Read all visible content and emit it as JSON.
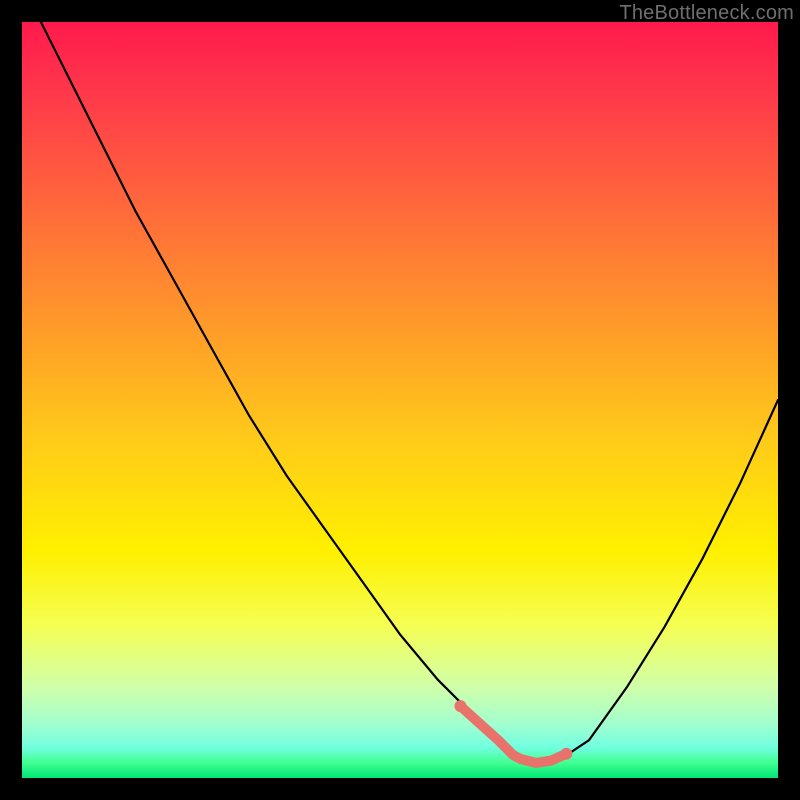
{
  "watermark": "TheBottleneck.com",
  "chart_data": {
    "type": "line",
    "title": "",
    "xlabel": "",
    "ylabel": "",
    "xlim": [
      0,
      100
    ],
    "ylim": [
      0,
      100
    ],
    "series": [
      {
        "name": "bottleneck-curve",
        "x": [
          0,
          5,
          10,
          15,
          20,
          25,
          30,
          35,
          40,
          45,
          50,
          55,
          60,
          63,
          65,
          66,
          68,
          70,
          72,
          75,
          80,
          85,
          90,
          95,
          100
        ],
        "values": [
          105,
          95,
          85,
          75,
          66,
          57,
          48,
          40,
          33,
          26,
          19,
          13,
          8,
          5,
          3,
          2.5,
          2,
          2.3,
          3,
          5,
          12,
          20,
          29,
          39,
          50
        ]
      },
      {
        "name": "highlight-segment",
        "x": [
          58,
          63,
          65,
          66,
          68,
          70,
          72
        ],
        "values": [
          9.5,
          5,
          3,
          2.5,
          2,
          2.3,
          3.2
        ]
      }
    ],
    "highlight_points": {
      "x": [
        58,
        72
      ],
      "values": [
        9.5,
        3.2
      ]
    },
    "colors": {
      "curve": "#000000",
      "highlight": "#e8736b",
      "gradient_top": "#ff1a4d",
      "gradient_bottom": "#00e676"
    }
  }
}
